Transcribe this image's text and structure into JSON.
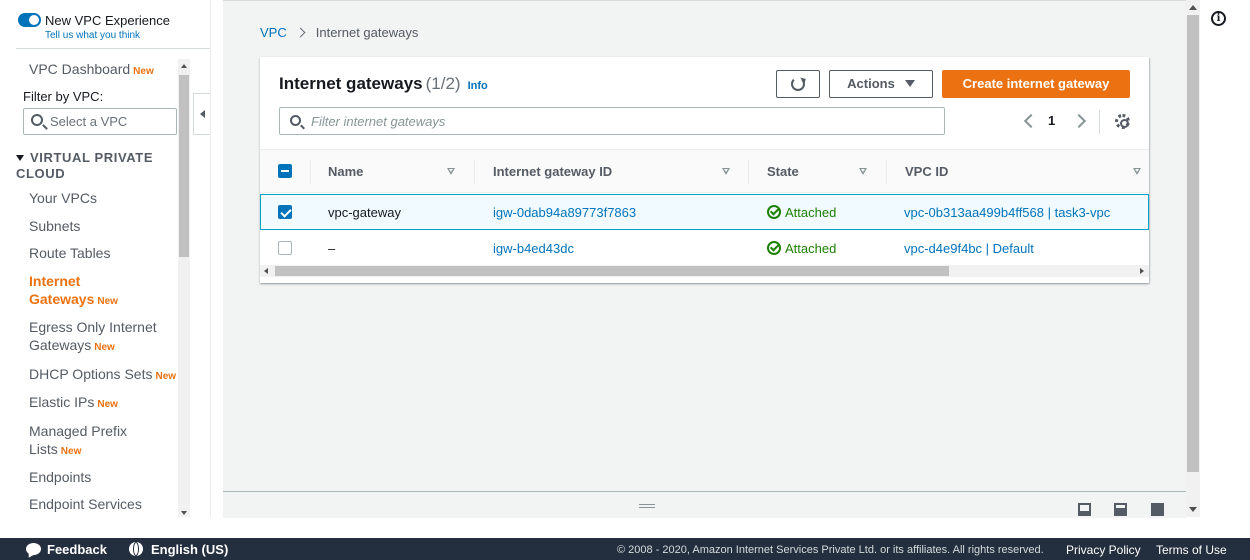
{
  "experience": {
    "toggle_label": "New VPC Experience",
    "feedback_link": "Tell us what you think"
  },
  "sidebar": {
    "dashboard": {
      "label": "VPC Dashboard",
      "badge": "New"
    },
    "filter_label": "Filter by VPC:",
    "select_placeholder": "Select a VPC",
    "section_title": "VIRTUAL PRIVATE CLOUD",
    "items": [
      {
        "label": "Your VPCs",
        "badge": ""
      },
      {
        "label": "Subnets",
        "badge": ""
      },
      {
        "label": "Route Tables",
        "badge": ""
      },
      {
        "label": "Internet Gateways",
        "badge": "New",
        "active": true
      },
      {
        "label": "Egress Only Internet Gateways",
        "badge": "New"
      },
      {
        "label": "DHCP Options Sets",
        "badge": "New"
      },
      {
        "label": "Elastic IPs",
        "badge": "New"
      },
      {
        "label": "Managed Prefix Lists",
        "badge": "New"
      },
      {
        "label": "Endpoints",
        "badge": ""
      },
      {
        "label": "Endpoint Services",
        "badge": ""
      }
    ]
  },
  "breadcrumb": {
    "root": "VPC",
    "current": "Internet gateways"
  },
  "panel": {
    "title": "Internet gateways",
    "count": "(1/2)",
    "info": "Info",
    "actions_label": "Actions",
    "create_label": "Create internet gateway",
    "filter_placeholder": "Filter internet gateways",
    "page": "1"
  },
  "table": {
    "columns": [
      "Name",
      "Internet gateway ID",
      "State",
      "VPC ID"
    ],
    "rows": [
      {
        "selected": true,
        "name": "vpc-gateway",
        "id": "igw-0dab94a89773f7863",
        "state": "Attached",
        "vpc": "vpc-0b313aa499b4ff568 | task3-vpc"
      },
      {
        "selected": false,
        "name": "–",
        "id": "igw-b4ed43dc",
        "state": "Attached",
        "vpc": "vpc-d4e9f4bc | Default"
      }
    ]
  },
  "footer": {
    "feedback": "Feedback",
    "language": "English (US)",
    "copyright": "© 2008 - 2020, Amazon Internet Services Private Ltd. or its affiliates. All rights reserved.",
    "privacy": "Privacy Policy",
    "terms": "Terms of Use"
  },
  "colors": {
    "accent": "#0073bb",
    "primary_button": "#ec7211",
    "status_ok": "#1d8102",
    "footer_bg": "#232f3e"
  }
}
